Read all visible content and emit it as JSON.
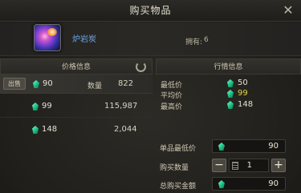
{
  "window": {
    "title": "购买物品",
    "close_icon": "close-icon"
  },
  "item": {
    "name": "炉岩炭",
    "owned_label": "拥有:",
    "owned_value": "6",
    "name_color": "#6aa4e6"
  },
  "price_panel": {
    "title": "价格信息",
    "sell_button": "出售",
    "listings": [
      {
        "price": "90",
        "qty_label": "数量",
        "qty": "822"
      },
      {
        "price": "99",
        "qty": "115,987"
      },
      {
        "price": "148",
        "qty": "2,044"
      }
    ]
  },
  "market_panel": {
    "title": "行情信息",
    "stats": [
      {
        "label": "最低价",
        "value": "50"
      },
      {
        "label": "平均价",
        "value": "99"
      },
      {
        "label": "最高价",
        "value": "148"
      }
    ],
    "avg_color": "#e8d64a"
  },
  "purchase": {
    "unit_min_label": "单品最低价",
    "unit_min_value": "90",
    "qty_label": "购买数量",
    "qty_value": "1",
    "minus": "−",
    "plus": "+",
    "total_label": "总购买金额",
    "total_value": "90"
  },
  "currency_icon": "jade-gem-icon"
}
